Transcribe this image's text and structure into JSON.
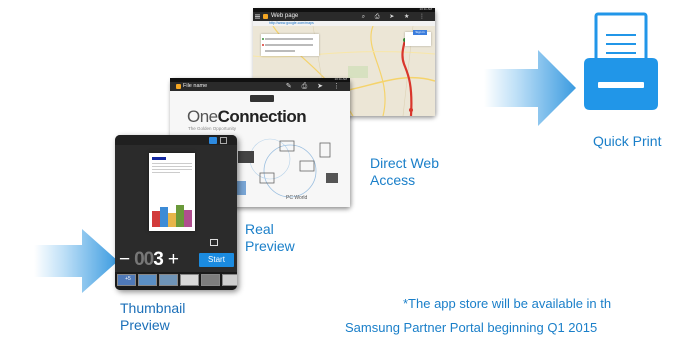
{
  "colors": {
    "accent": "#1a7fc9",
    "arrow_light": "#cfe8f9",
    "arrow_dark": "#3b9be0",
    "printer": "#2196e8",
    "start_button": "#1b8be0"
  },
  "web_tablet": {
    "title": "Web page",
    "status_time": "10:11 AM",
    "url": "http://www.google.com/maps",
    "signin_label": "Sign in",
    "icons": [
      "menu-icon",
      "browser-icon",
      "search-icon",
      "print-icon",
      "share-icon",
      "star-icon",
      "more-icon"
    ]
  },
  "file_tablet": {
    "title": "File name",
    "status_time": "10:11 AM",
    "brand_prefix": "One",
    "brand_bold": "Connection",
    "tagline": "The Golden Opportunity",
    "pc_world": "PC World"
  },
  "thumb_tablet": {
    "counter_minus": "−",
    "counter_zeros": "00",
    "counter_value": "3",
    "counter_plus": "+",
    "start_label": "Start",
    "tile_badge": "+5"
  },
  "captions": {
    "direct_web_line1": "Direct Web",
    "direct_web_line2": "Access",
    "quick_print": "Quick Print",
    "real_preview_line1": "Real",
    "real_preview_line2": "Preview",
    "thumbnail_line1": "Thumbnail",
    "thumbnail_line2": "Preview"
  },
  "footnote": {
    "line1": "*The app store will be available in th",
    "line2": "Samsung Partner Portal beginning Q1 2015"
  }
}
